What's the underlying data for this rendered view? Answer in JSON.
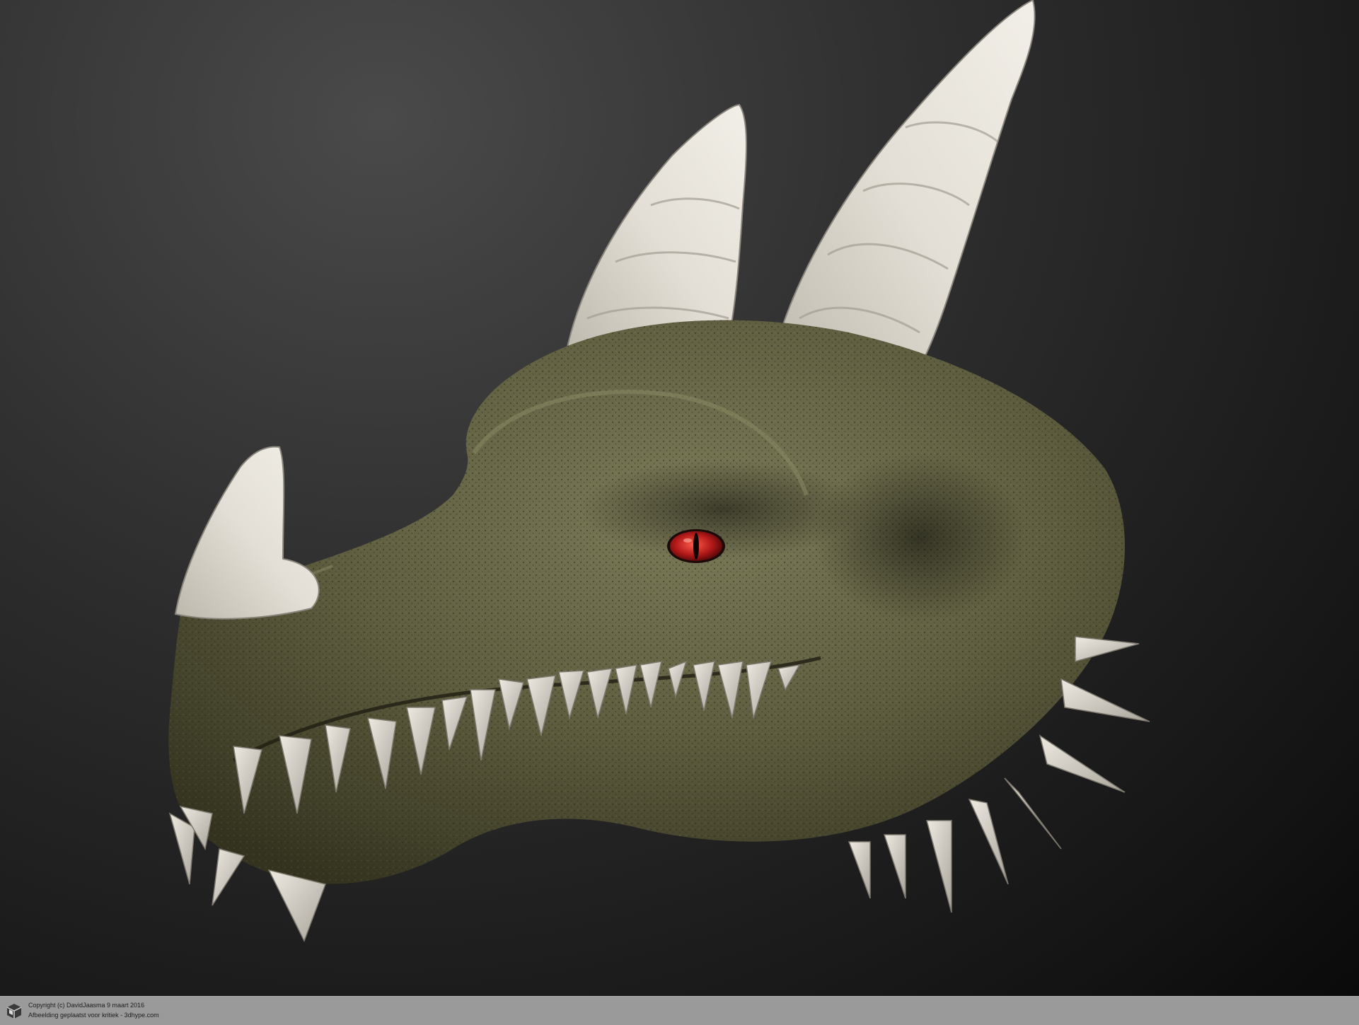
{
  "footer": {
    "copyright": "Copyright (c) DavidJaasma 9 maart 2016",
    "note": "Afbeelding geplaatst voor kritiek - 3dhype.com",
    "logo_icon": "3dhype-cube-icon"
  },
  "colors": {
    "background": "#1e1e1e",
    "skin": "#6b6a4a",
    "horn": "#d6d2c8",
    "eye": "#b01818",
    "footer_bar": "#9a9a9a"
  }
}
